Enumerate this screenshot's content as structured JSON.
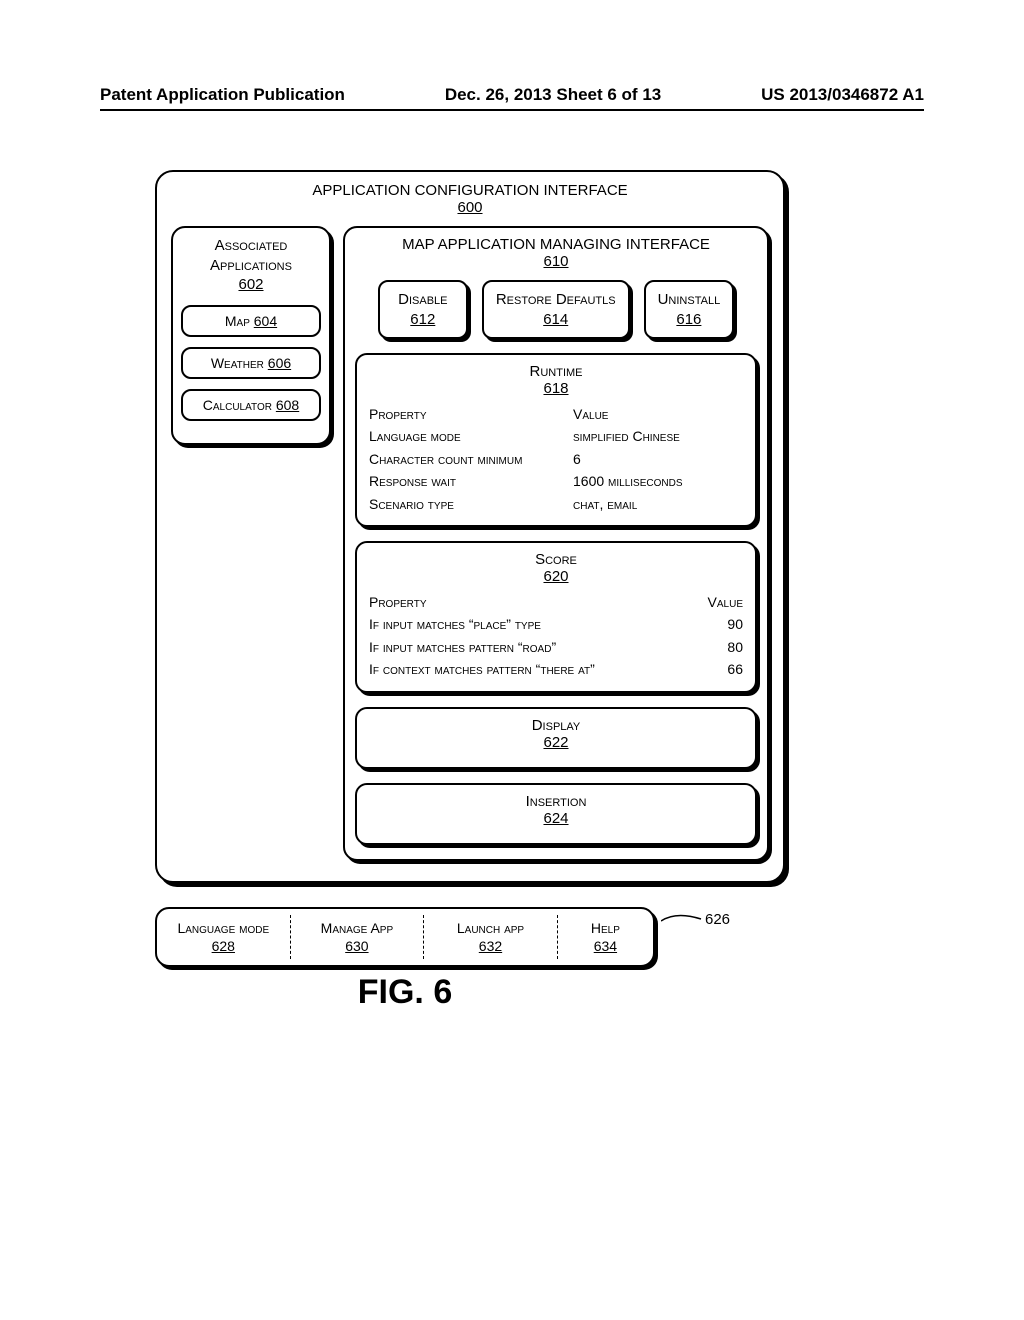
{
  "header": {
    "left": "Patent Application Publication",
    "center": "Dec. 26, 2013  Sheet 6 of 13",
    "right": "US 2013/0346872 A1"
  },
  "outer": {
    "title": "APPLICATION CONFIGURATION INTERFACE",
    "ref": "600"
  },
  "sidebar": {
    "title": "Associated Applications",
    "ref": "602",
    "items": [
      {
        "label": "Map",
        "ref": "604"
      },
      {
        "label": "Weather",
        "ref": "606"
      },
      {
        "label": "Calculator",
        "ref": "608"
      }
    ]
  },
  "managing": {
    "title": "MAP APPLICATION MANAGING INTERFACE",
    "ref": "610",
    "buttons": [
      {
        "label": "Disable",
        "ref": "612"
      },
      {
        "label": "Restore Defautls",
        "ref": "614"
      },
      {
        "label": "Uninstall",
        "ref": "616"
      }
    ]
  },
  "runtime": {
    "title": "Runtime",
    "ref": "618",
    "header_prop": "Property",
    "header_val": "Value",
    "rows": [
      {
        "prop": "Language mode",
        "val": "simplified Chinese"
      },
      {
        "prop": "Character count minimum",
        "val": "6"
      },
      {
        "prop": "Response wait",
        "val": "1600 milliseconds"
      },
      {
        "prop": "Scenario type",
        "val": "chat, email"
      }
    ]
  },
  "score": {
    "title": "Score",
    "ref": "620",
    "header_prop": "Property",
    "header_val": "Value",
    "rows": [
      {
        "prop": "If input matches “place” type",
        "val": "90"
      },
      {
        "prop": "If input matches pattern “road”",
        "val": "80"
      },
      {
        "prop": "If context matches pattern “there at”",
        "val": "66"
      }
    ]
  },
  "display": {
    "title": "Display",
    "ref": "622"
  },
  "insertion": {
    "title": "Insertion",
    "ref": "624"
  },
  "inputpanel": {
    "ref": "626",
    "items": [
      {
        "label": "Language mode",
        "ref": "628"
      },
      {
        "label": "Manage App",
        "ref": "630"
      },
      {
        "label": "Launch app",
        "ref": "632"
      },
      {
        "label": "Help",
        "ref": "634"
      }
    ]
  },
  "figlabel": "FIG. 6"
}
